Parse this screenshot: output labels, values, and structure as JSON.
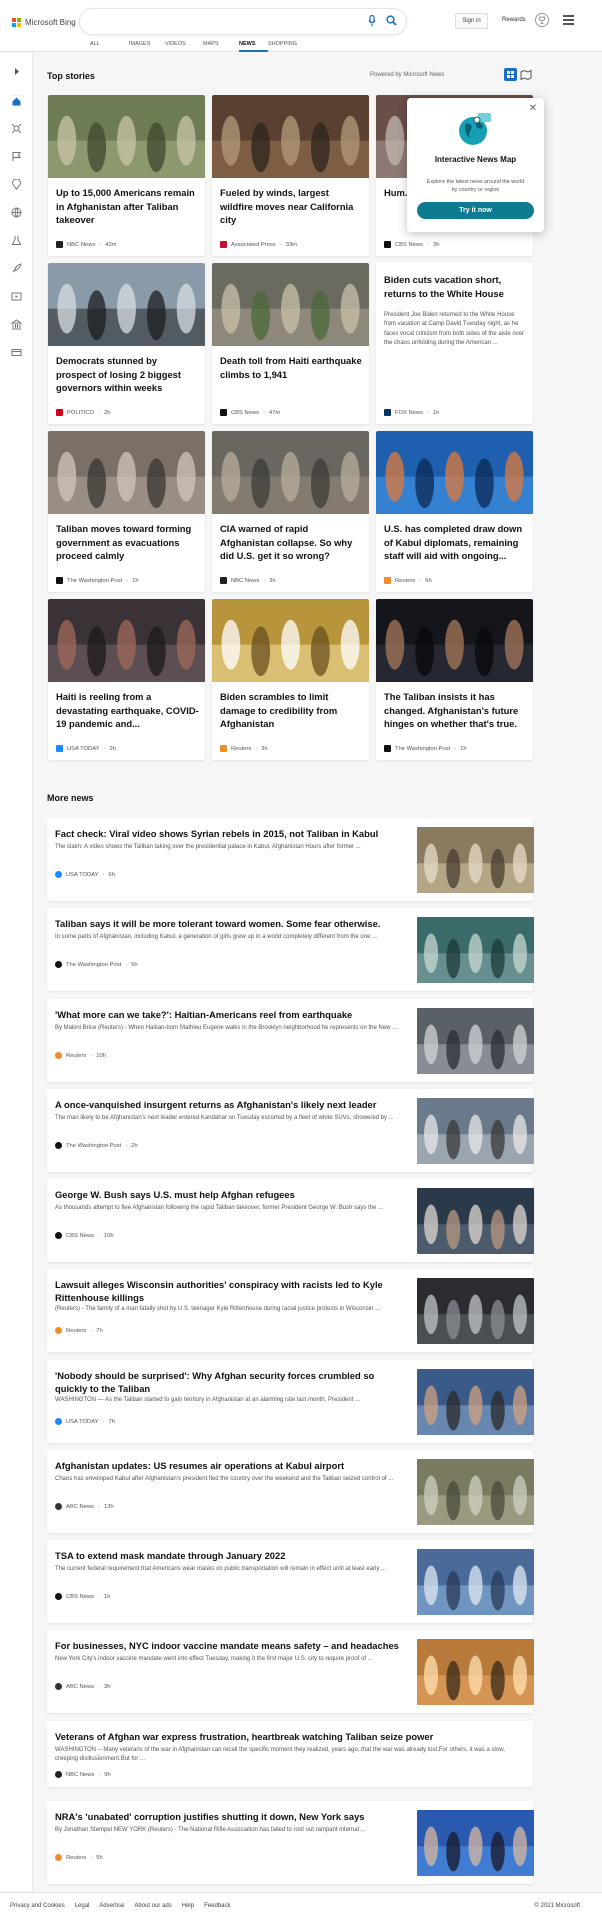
{
  "header": {
    "brand": "Microsoft Bing",
    "signin": "Sign in",
    "rewards": "Rewards"
  },
  "scopes": [
    "ALL",
    "IMAGES",
    "VIDEOS",
    "MAPS",
    "NEWS",
    "SHOPPING"
  ],
  "active_scope": "NEWS",
  "colors": {
    "accent": "#1b6fc2",
    "teal": "#0f7b91"
  },
  "top_stories": {
    "heading": "Top stories",
    "powered_by": "Powered by Microsoft News",
    "cards": [
      {
        "title": "Up to 15,000 Americans remain in Afghanistan after Taliban takeover",
        "source": "NBC News",
        "time": "43m",
        "logo_color": "#222"
      },
      {
        "title": "Fueled by winds, largest wildfire moves near California city",
        "source": "Associated Press",
        "time": "33m",
        "logo_color": "#c8102e"
      },
      {
        "title": "Hum... well c...",
        "source": "CBS News",
        "time": "3h",
        "logo_color": "#111"
      },
      {
        "title": "Democrats stunned by prospect of losing 2 biggest governors within weeks",
        "source": "POLITICO",
        "time": "2h",
        "logo_color": "#d0021b"
      },
      {
        "title": "Death toll from Haiti earthquake climbs to 1,941",
        "source": "CBS News",
        "time": "47m",
        "logo_color": "#111"
      },
      {
        "title": "Biden cuts vacation short, returns to the White House",
        "snippet": "President Joe Biden returned to the White House from vacation at Camp David Tuesday night, as he faces vocal criticism from both sides of the aisle over the chaos unfolding during the American ...",
        "source": "FOX News",
        "time": "1h",
        "logo_color": "#003366"
      },
      {
        "title": "Taliban moves toward forming government as evacuations proceed calmly",
        "source": "The Washington Post",
        "time": "1h",
        "logo_color": "#111"
      },
      {
        "title": "CIA warned of rapid Afghanistan collapse. So why did U.S. get it so wrong?",
        "source": "NBC News",
        "time": "3h",
        "logo_color": "#222"
      },
      {
        "title": "U.S. has completed draw down of Kabul diplomats, remaining staff will aid with ongoing...",
        "source": "Reuters",
        "time": "6h",
        "logo_color": "#f28c28"
      },
      {
        "title": "Haiti is reeling from a devastating earthquake, COVID-19 pandemic and...",
        "source": "USA TODAY",
        "time": "2h",
        "logo_color": "#1a8cff"
      },
      {
        "title": "Biden scrambles to limit damage to credibility from Afghanistan",
        "source": "Reuters",
        "time": "3h",
        "logo_color": "#f28c28"
      },
      {
        "title": "The Taliban insists it has changed. Afghanistan's future hinges on whether that's true.",
        "source": "The Washington Post",
        "time": "1h",
        "logo_color": "#111"
      }
    ]
  },
  "popup": {
    "title": "Interactive News Map",
    "description": "Explore the latest news around the world by country or region",
    "button": "Try it now",
    "close": "✕"
  },
  "more_news": {
    "heading": "More news",
    "items": [
      {
        "title": "Fact check: Viral video shows Syrian rebels in 2015, not Taliban in Kabul",
        "snippet": "The claim: A video shows the Taliban taking over the presidential palace in Kabul, Afghanistan Hours after former ...",
        "source": "USA TODAY",
        "time": "6h",
        "logo_color": "#1a8cff",
        "has_image": true
      },
      {
        "title": "Taliban says it will be more tolerant toward women. Some fear otherwise.",
        "snippet": "In some parts of Afghanistan, including Kabul, a generation of girls grew up in a world completely different from the one ...",
        "source": "The Washington Post",
        "time": "5h",
        "logo_color": "#111",
        "has_image": true
      },
      {
        "title": "'What more can we take?': Haitian-Americans reel from earthquake",
        "snippet": "By Makini Brice (Reuters) - When Haitian-born Mathieu Eugene walks in the Brooklyn neighborhood he represents on the New ...",
        "source": "Reuters",
        "time": "10h",
        "logo_color": "#f28c28",
        "has_image": true
      },
      {
        "title": "A once-vanquished insurgent returns as Afghanistan's likely next leader",
        "snippet": "The man likely to be Afghanistan's next leader entered Kandahar on Tuesday escorted by a fleet of white SUVs, showered by ...",
        "source": "The Washington Post",
        "time": "2h",
        "logo_color": "#111",
        "has_image": true
      },
      {
        "title": "George W. Bush says U.S. must help Afghan refugees",
        "snippet": "As thousands attempt to flee Afghanistan following the rapid Taliban takeover, former President George W. Bush says the ...",
        "source": "CBS News",
        "time": "10h",
        "logo_color": "#111",
        "has_image": true
      },
      {
        "title": "Lawsuit alleges Wisconsin authorities' conspiracy with racists led to Kyle Rittenhouse killings",
        "snippet": "(Reuters) - The family of a man fatally shot by U.S. teenager Kyle Rittenhouse during racial justice protests in Wisconsin ...",
        "source": "Reuters",
        "time": "7h",
        "logo_color": "#f28c28",
        "has_image": true
      },
      {
        "title": "'Nobody should be surprised': Why Afghan security forces crumbled so quickly to the Taliban",
        "snippet": "WASHINGTON — As the Taliban started to gain territory in Afghanistan at an alarming rate last month, President ...",
        "source": "USA TODAY",
        "time": "7h",
        "logo_color": "#1a8cff",
        "has_image": true
      },
      {
        "title": "Afghanistan updates: US resumes air operations at Kabul airport",
        "snippet": "Chaos has enveloped Kabul after Afghanistan's president fled the country over the weekend and the Taliban seized control of ...",
        "source": "ABC News",
        "time": "13h",
        "logo_color": "#333",
        "has_image": true
      },
      {
        "title": "TSA to extend mask mandate through January 2022",
        "snippet": "The current federal requirement that Americans wear masks on public transportation will remain in effect until at least early ...",
        "source": "CBS News",
        "time": "1h",
        "logo_color": "#111",
        "has_image": true
      },
      {
        "title": "For businesses, NYC indoor vaccine mandate means safety – and headaches",
        "snippet": "New York City's indoor vaccine mandate went into effect Tuesday, making it the first major U.S. city to require proof of ...",
        "source": "ABC News",
        "time": "3h",
        "logo_color": "#333",
        "has_image": true
      },
      {
        "title": "Veterans of Afghan war express frustration, heartbreak watching Taliban seize power",
        "snippet": "WASHINGTON -- Many veterans of the war in Afghanistan can recall the specific moment they realized, years ago, that the war was already lost.For others, it was a slow, creeping disillusionment.But for ...",
        "source": "NBC News",
        "time": "9h",
        "logo_color": "#222",
        "has_image": false
      },
      {
        "title": "NRA's 'unabated' corruption justifies shutting it down, New York says",
        "snippet": "By Jonathan Stempel NEW YORK (Reuters) - The National Rifle Association has failed to root out rampant internal ...",
        "source": "Reuters",
        "time": "5h",
        "logo_color": "#f28c28",
        "has_image": true
      }
    ]
  },
  "footer": {
    "links": [
      "Privacy and Cookies",
      "Legal",
      "Advertise",
      "About our ads",
      "Help",
      "Feedback"
    ],
    "copyright": "© 2021 Microsoft"
  }
}
